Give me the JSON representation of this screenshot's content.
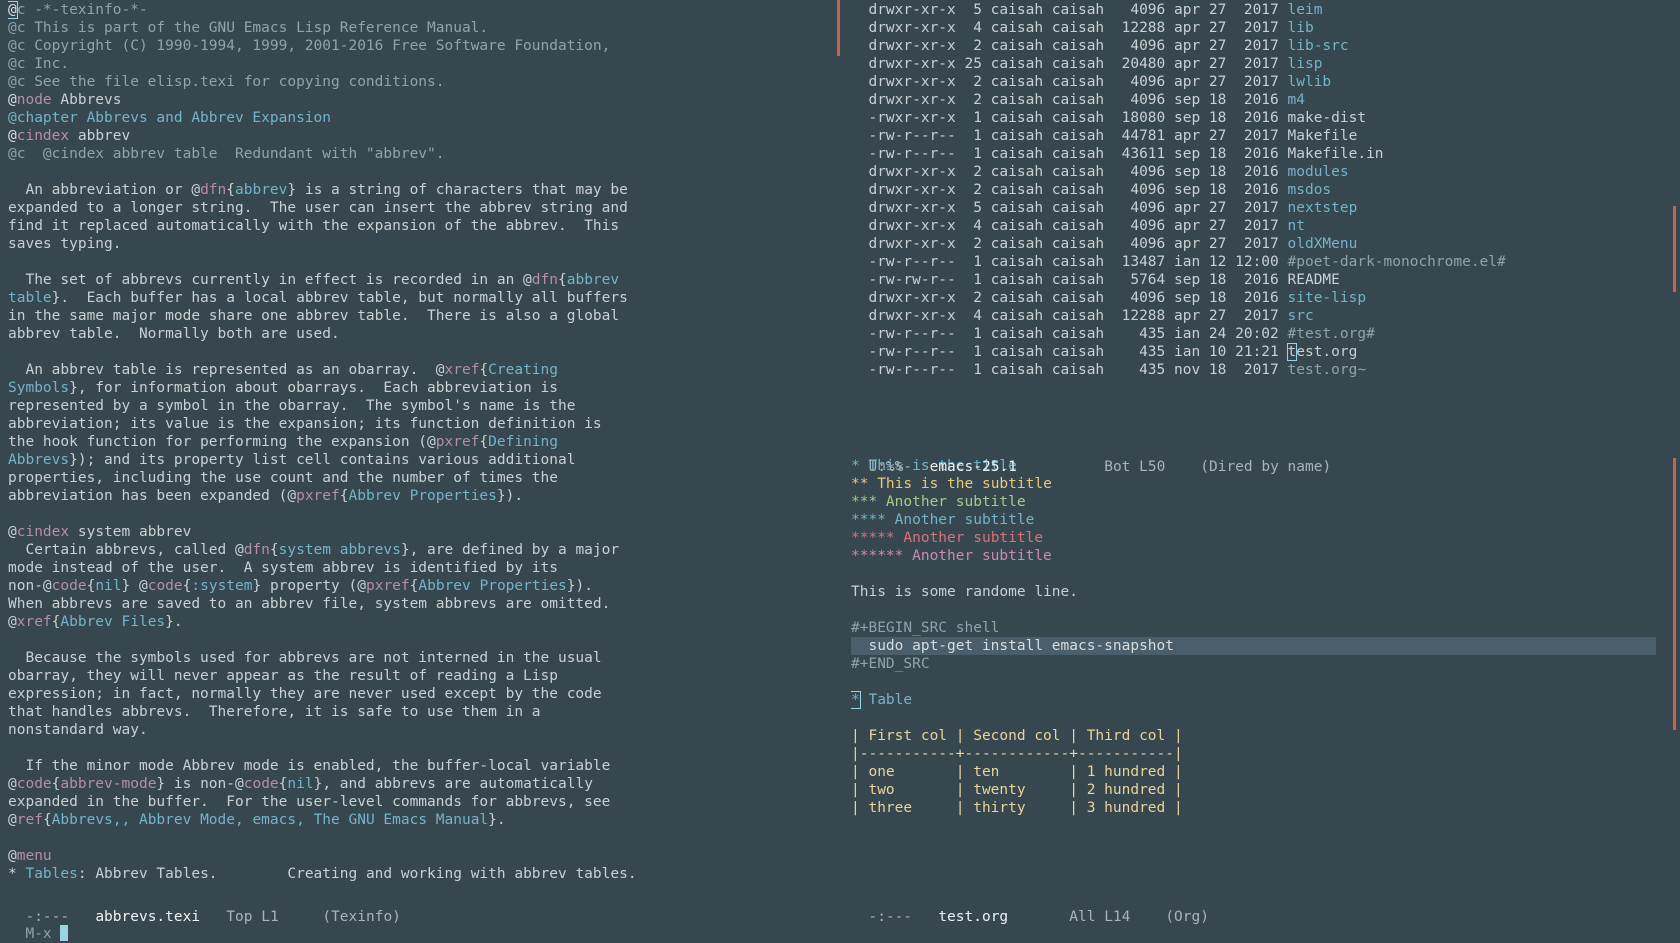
{
  "left_buffer": {
    "lines": [
      [
        [
          "at",
          "@"
        ],
        [
          "comment",
          "c -*-texinfo-*-"
        ]
      ],
      [
        [
          "comment",
          "@c This is part of the GNU Emacs Lisp Reference Manual."
        ]
      ],
      [
        [
          "comment",
          "@c Copyright (C) 1990-1994, 1999, 2001-2016 Free Software Foundation,"
        ]
      ],
      [
        [
          "comment",
          "@c Inc."
        ]
      ],
      [
        [
          "comment",
          "@c See the file elisp.texi for copying conditions."
        ]
      ],
      [
        [
          "at",
          "@"
        ],
        [
          "key",
          "node"
        ],
        [
          "text",
          " Abbrevs"
        ]
      ],
      [
        [
          "link",
          "@chapter Abbrevs and Abbrev Expansion"
        ]
      ],
      [
        [
          "at",
          "@"
        ],
        [
          "key",
          "cindex"
        ],
        [
          "text",
          " abbrev"
        ]
      ],
      [
        [
          "comment",
          "@c  @cindex abbrev table  Redundant with \"abbrev\"."
        ]
      ],
      [
        [
          "text",
          ""
        ]
      ],
      [
        [
          "text",
          "  An abbreviation or @"
        ],
        [
          "key",
          "dfn"
        ],
        [
          "text",
          "{"
        ],
        [
          "link",
          "abbrev"
        ],
        [
          "text",
          "} is a string of characters that may be"
        ]
      ],
      [
        [
          "text",
          "expanded to a longer string.  The user can insert the abbrev string and"
        ]
      ],
      [
        [
          "text",
          "find it replaced automatically with the expansion of the abbrev.  This"
        ]
      ],
      [
        [
          "text",
          "saves typing."
        ]
      ],
      [
        [
          "text",
          ""
        ]
      ],
      [
        [
          "text",
          "  The set of abbrevs currently in effect is recorded in an @"
        ],
        [
          "key",
          "dfn"
        ],
        [
          "text",
          "{"
        ],
        [
          "link",
          "abbrev"
        ]
      ],
      [
        [
          "link",
          "table"
        ],
        [
          "text",
          "}.  Each buffer has a local abbrev table, but normally all buffers"
        ]
      ],
      [
        [
          "text",
          "in the same major mode share one abbrev table.  There is also a global"
        ]
      ],
      [
        [
          "text",
          "abbrev table.  Normally both are used."
        ]
      ],
      [
        [
          "text",
          ""
        ]
      ],
      [
        [
          "text",
          "  An abbrev table is represented as an obarray.  @"
        ],
        [
          "key",
          "xref"
        ],
        [
          "text",
          "{"
        ],
        [
          "link",
          "Creating"
        ]
      ],
      [
        [
          "link",
          "Symbols"
        ],
        [
          "text",
          "}, for information about obarrays.  Each abbreviation is"
        ]
      ],
      [
        [
          "text",
          "represented by a symbol in the obarray.  The symbol's name is the"
        ]
      ],
      [
        [
          "text",
          "abbreviation; its value is the expansion; its function definition is"
        ]
      ],
      [
        [
          "text",
          "the hook function for performing the expansion (@"
        ],
        [
          "key",
          "pxref"
        ],
        [
          "text",
          "{"
        ],
        [
          "link",
          "Defining"
        ]
      ],
      [
        [
          "link",
          "Abbrevs"
        ],
        [
          "text",
          "}); and its property list cell contains various additional"
        ]
      ],
      [
        [
          "text",
          "properties, including the use count and the number of times the"
        ]
      ],
      [
        [
          "text",
          "abbreviation has been expanded (@"
        ],
        [
          "key",
          "pxref"
        ],
        [
          "text",
          "{"
        ],
        [
          "link",
          "Abbrev Properties"
        ],
        [
          "text",
          "})."
        ]
      ],
      [
        [
          "text",
          ""
        ]
      ],
      [
        [
          "text",
          "@"
        ],
        [
          "key",
          "cindex"
        ],
        [
          "text",
          " system abbrev"
        ]
      ],
      [
        [
          "text",
          "  Certain abbrevs, called @"
        ],
        [
          "key",
          "dfn"
        ],
        [
          "text",
          "{"
        ],
        [
          "link",
          "system abbrevs"
        ],
        [
          "text",
          "}, are defined by a major"
        ]
      ],
      [
        [
          "text",
          "mode instead of the user.  A system abbrev is identified by its"
        ]
      ],
      [
        [
          "text",
          "non-@"
        ],
        [
          "key",
          "code"
        ],
        [
          "text",
          "{"
        ],
        [
          "link",
          "nil"
        ],
        [
          "text",
          "} @"
        ],
        [
          "key",
          "code"
        ],
        [
          "text",
          "{"
        ],
        [
          "link",
          ":system"
        ],
        [
          "text",
          "} property (@"
        ],
        [
          "key",
          "pxref"
        ],
        [
          "text",
          "{"
        ],
        [
          "link",
          "Abbrev Properties"
        ],
        [
          "text",
          "})."
        ]
      ],
      [
        [
          "text",
          "When abbrevs are saved to an abbrev file, system abbrevs are omitted."
        ]
      ],
      [
        [
          "text",
          "@"
        ],
        [
          "key",
          "xref"
        ],
        [
          "text",
          "{"
        ],
        [
          "link",
          "Abbrev Files"
        ],
        [
          "text",
          "}."
        ]
      ],
      [
        [
          "text",
          ""
        ]
      ],
      [
        [
          "text",
          "  Because the symbols used for abbrevs are not interned in the usual"
        ]
      ],
      [
        [
          "text",
          "obarray, they will never appear as the result of reading a Lisp"
        ]
      ],
      [
        [
          "text",
          "expression; in fact, normally they are never used except by the code"
        ]
      ],
      [
        [
          "text",
          "that handles abbrevs.  Therefore, it is safe to use them in a"
        ]
      ],
      [
        [
          "text",
          "nonstandard way."
        ]
      ],
      [
        [
          "text",
          ""
        ]
      ],
      [
        [
          "text",
          "  If the minor mode Abbrev mode is enabled, the buffer-local variable"
        ]
      ],
      [
        [
          "text",
          "@"
        ],
        [
          "key",
          "code"
        ],
        [
          "text",
          "{"
        ],
        [
          "key",
          "abbrev-mode"
        ],
        [
          "text",
          "} is non-@"
        ],
        [
          "key",
          "code"
        ],
        [
          "text",
          "{"
        ],
        [
          "link",
          "nil"
        ],
        [
          "text",
          "}, and abbrevs are automatically"
        ]
      ],
      [
        [
          "text",
          "expanded in the buffer.  For the user-level commands for abbrevs, see"
        ]
      ],
      [
        [
          "text",
          "@"
        ],
        [
          "key",
          "ref"
        ],
        [
          "text",
          "{"
        ],
        [
          "link",
          "Abbrevs,, Abbrev Mode, emacs, The GNU Emacs Manual"
        ],
        [
          "text",
          "}."
        ]
      ],
      [
        [
          "text",
          ""
        ]
      ],
      [
        [
          "text",
          "@"
        ],
        [
          "key",
          "menu"
        ]
      ],
      [
        [
          "text",
          "* "
        ],
        [
          "link",
          "Tables"
        ],
        [
          "text",
          ": Abbrev Tables.        Creating and working with abbrev tables."
        ]
      ]
    ],
    "modeline": {
      "status": "-:---",
      "buffer": "abbrevs.texi",
      "position": "Top L1",
      "mode": "(Texinfo)"
    }
  },
  "dired": {
    "entries": [
      {
        "perms": "drwxr-xr-x",
        "links": "5",
        "owner": "caisah",
        "group": "caisah",
        "size": "4096",
        "month": "apr",
        "day": "27",
        "time": "2017",
        "name": "leim",
        "kind": "dir"
      },
      {
        "perms": "drwxr-xr-x",
        "links": "4",
        "owner": "caisah",
        "group": "caisah",
        "size": "12288",
        "month": "apr",
        "day": "27",
        "time": "2017",
        "name": "lib",
        "kind": "dir"
      },
      {
        "perms": "drwxr-xr-x",
        "links": "2",
        "owner": "caisah",
        "group": "caisah",
        "size": "4096",
        "month": "apr",
        "day": "27",
        "time": "2017",
        "name": "lib-src",
        "kind": "dir"
      },
      {
        "perms": "drwxr-xr-x",
        "links": "25",
        "owner": "caisah",
        "group": "caisah",
        "size": "20480",
        "month": "apr",
        "day": "27",
        "time": "2017",
        "name": "lisp",
        "kind": "dir"
      },
      {
        "perms": "drwxr-xr-x",
        "links": "2",
        "owner": "caisah",
        "group": "caisah",
        "size": "4096",
        "month": "apr",
        "day": "27",
        "time": "2017",
        "name": "lwlib",
        "kind": "dir"
      },
      {
        "perms": "drwxr-xr-x",
        "links": "2",
        "owner": "caisah",
        "group": "caisah",
        "size": "4096",
        "month": "sep",
        "day": "18",
        "time": "2016",
        "name": "m4",
        "kind": "dir"
      },
      {
        "perms": "-rwxr-xr-x",
        "links": "1",
        "owner": "caisah",
        "group": "caisah",
        "size": "18080",
        "month": "sep",
        "day": "18",
        "time": "2016",
        "name": "make-dist",
        "kind": "file"
      },
      {
        "perms": "-rw-r--r--",
        "links": "1",
        "owner": "caisah",
        "group": "caisah",
        "size": "44781",
        "month": "apr",
        "day": "27",
        "time": "2017",
        "name": "Makefile",
        "kind": "file"
      },
      {
        "perms": "-rw-r--r--",
        "links": "1",
        "owner": "caisah",
        "group": "caisah",
        "size": "43611",
        "month": "sep",
        "day": "18",
        "time": "2016",
        "name": "Makefile.in",
        "kind": "file"
      },
      {
        "perms": "drwxr-xr-x",
        "links": "2",
        "owner": "caisah",
        "group": "caisah",
        "size": "4096",
        "month": "sep",
        "day": "18",
        "time": "2016",
        "name": "modules",
        "kind": "dir"
      },
      {
        "perms": "drwxr-xr-x",
        "links": "2",
        "owner": "caisah",
        "group": "caisah",
        "size": "4096",
        "month": "sep",
        "day": "18",
        "time": "2016",
        "name": "msdos",
        "kind": "dir"
      },
      {
        "perms": "drwxr-xr-x",
        "links": "5",
        "owner": "caisah",
        "group": "caisah",
        "size": "4096",
        "month": "apr",
        "day": "27",
        "time": "2017",
        "name": "nextstep",
        "kind": "dir"
      },
      {
        "perms": "drwxr-xr-x",
        "links": "4",
        "owner": "caisah",
        "group": "caisah",
        "size": "4096",
        "month": "apr",
        "day": "27",
        "time": "2017",
        "name": "nt",
        "kind": "dir"
      },
      {
        "perms": "drwxr-xr-x",
        "links": "2",
        "owner": "caisah",
        "group": "caisah",
        "size": "4096",
        "month": "apr",
        "day": "27",
        "time": "2017",
        "name": "oldXMenu",
        "kind": "dir"
      },
      {
        "perms": "-rw-r--r--",
        "links": "1",
        "owner": "caisah",
        "group": "caisah",
        "size": "13487",
        "month": "ian",
        "day": "12",
        "time": "12:00",
        "name": "#poet-dark-monochrome.el#",
        "kind": "dim"
      },
      {
        "perms": "-rw-rw-r--",
        "links": "1",
        "owner": "caisah",
        "group": "caisah",
        "size": "5764",
        "month": "sep",
        "day": "18",
        "time": "2016",
        "name": "README",
        "kind": "file"
      },
      {
        "perms": "drwxr-xr-x",
        "links": "2",
        "owner": "caisah",
        "group": "caisah",
        "size": "4096",
        "month": "sep",
        "day": "18",
        "time": "2016",
        "name": "site-lisp",
        "kind": "dir"
      },
      {
        "perms": "drwxr-xr-x",
        "links": "4",
        "owner": "caisah",
        "group": "caisah",
        "size": "12288",
        "month": "apr",
        "day": "27",
        "time": "2017",
        "name": "src",
        "kind": "dir"
      },
      {
        "perms": "-rw-r--r--",
        "links": "1",
        "owner": "caisah",
        "group": "caisah",
        "size": "435",
        "month": "ian",
        "day": "24",
        "time": "20:02",
        "name": "#test.org#",
        "kind": "dim"
      },
      {
        "perms": "-rw-r--r--",
        "links": "1",
        "owner": "caisah",
        "group": "caisah",
        "size": "435",
        "month": "ian",
        "day": "10",
        "time": "21:21",
        "name": "test.org",
        "kind": "file"
      },
      {
        "perms": "-rw-r--r--",
        "links": "1",
        "owner": "caisah",
        "group": "caisah",
        "size": "435",
        "month": "nov",
        "day": "18",
        "time": "2017",
        "name": "test.org~",
        "kind": "dim"
      }
    ],
    "modeline": {
      "status": "U:%%-",
      "buffer": "emacs-25.1",
      "position": "Bot L50",
      "mode": "(Dired by name)"
    }
  },
  "org": {
    "headings": [
      {
        "stars": "*",
        "text": "This is the title",
        "level": 1
      },
      {
        "stars": "**",
        "text": "This is the subtitle",
        "level": 2
      },
      {
        "stars": "***",
        "text": "Another subtitle",
        "level": 3
      },
      {
        "stars": "****",
        "text": "Another subtitle",
        "level": 4
      },
      {
        "stars": "*****",
        "text": "Another subtitle",
        "level": 5
      },
      {
        "stars": "******",
        "text": "Another subtitle",
        "level": 6
      }
    ],
    "paragraph": "This is some randome line.",
    "src_begin": "#+BEGIN_SRC shell",
    "src_body": "  sudo apt-get install emacs-snapshot",
    "src_end": "#+END_SRC",
    "table_heading": {
      "star": "*",
      "text": " Table"
    },
    "table": {
      "header": "| First col | Second col | Third col |",
      "separator": "|-----------+------------+-----------|",
      "rows": [
        "| one       | ten        | 1 hundred |",
        "| two       | twenty     | 2 hundred |",
        "| three     | thirty     | 3 hundred |"
      ]
    },
    "modeline": {
      "status": "-:---",
      "buffer": "test.org",
      "position": "All L14",
      "mode": "(Org)"
    }
  },
  "minibuffer": {
    "prompt": "M-x "
  }
}
